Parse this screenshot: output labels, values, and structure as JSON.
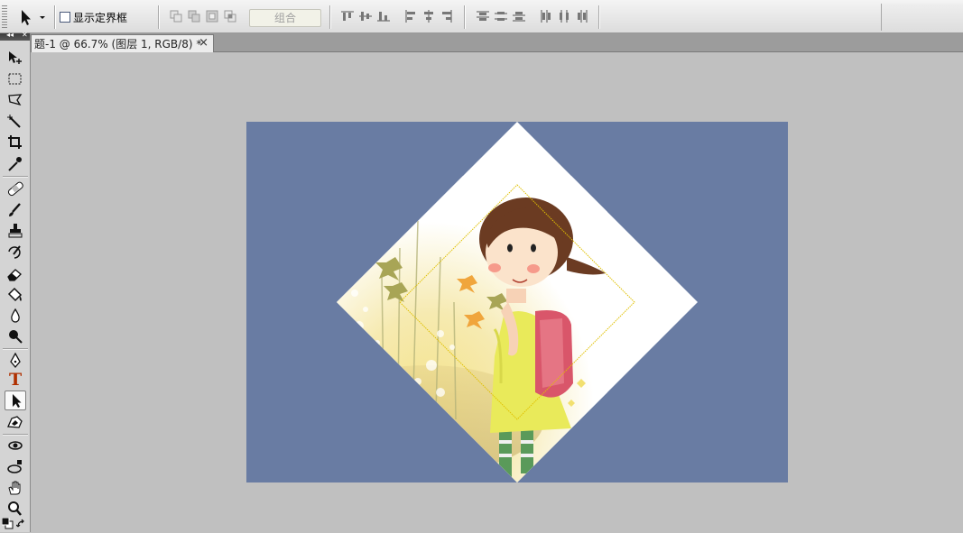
{
  "options_bar": {
    "show_bounding_box_label": "显示定界框",
    "combine_label": "组合",
    "icons": [
      "move-tool-icon",
      "dropdown-arrow-icon",
      "new-shape-layer-icon",
      "add-shape-icon",
      "subtract-shape-icon",
      "intersect-shape-icon",
      "align-top-icon",
      "align-vcenter-icon",
      "align-bottom-icon",
      "align-left-icon",
      "align-hcenter-icon",
      "align-right-icon",
      "distribute-top-icon",
      "distribute-vcenter-icon",
      "distribute-bottom-icon",
      "distribute-left-icon",
      "distribute-hcenter-icon",
      "distribute-right-icon"
    ]
  },
  "document_tab": {
    "title": "题-1 @ 66.7% (图层 1, RGB/8) *",
    "close_glyph": "×"
  },
  "toolbox": {
    "collapse_glyph": "◂◂",
    "close_glyph": "✕",
    "tools": [
      "move-tool",
      "marquee-tool",
      "lasso-tool",
      "magic-wand-tool",
      "crop-tool",
      "eyedropper-tool",
      "healing-brush-tool",
      "brush-tool",
      "clone-stamp-tool",
      "history-brush-tool",
      "eraser-tool",
      "paint-bucket-tool",
      "blur-tool",
      "dodge-tool",
      "pen-tool",
      "type-tool",
      "path-selection-tool",
      "custom-shape-tool",
      "3d-rotate-tool",
      "3d-orbit-tool",
      "hand-tool",
      "zoom-tool",
      "color-swatches",
      "swap-colors"
    ],
    "active_tool": "path-selection-tool",
    "type_tool_glyph": "T"
  },
  "canvas": {
    "background_color": "#697ca3",
    "pasteboard_color": "#c0c0c0",
    "diamond_fill": "#ffffff",
    "path_outline_color": "#e0c000"
  }
}
